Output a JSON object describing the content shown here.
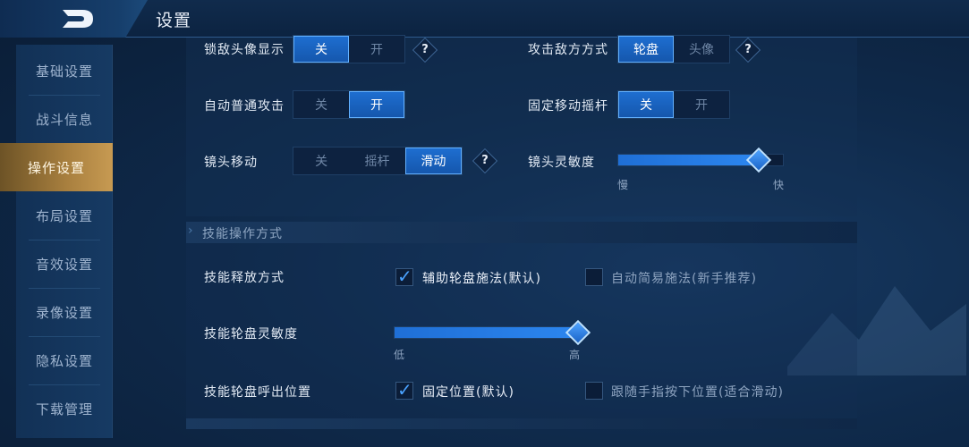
{
  "header": {
    "title": "设置"
  },
  "sidebar": {
    "items": [
      {
        "label": "基础设置"
      },
      {
        "label": "战斗信息"
      },
      {
        "label": "操作设置"
      },
      {
        "label": "布局设置"
      },
      {
        "label": "音效设置"
      },
      {
        "label": "录像设置"
      },
      {
        "label": "隐私设置"
      },
      {
        "label": "下载管理"
      }
    ],
    "active_index": 2
  },
  "settings": {
    "lock_enemy_avatar": {
      "label": "锁敌头像显示",
      "options": [
        "关",
        "开"
      ],
      "selected": "关"
    },
    "attack_enemy_mode": {
      "label": "攻击敌方方式",
      "options": [
        "轮盘",
        "头像"
      ],
      "selected": "轮盘"
    },
    "auto_attack": {
      "label": "自动普通攻击",
      "options": [
        "关",
        "开"
      ],
      "selected": "开"
    },
    "fixed_joystick": {
      "label": "固定移动摇杆",
      "options": [
        "关",
        "开"
      ],
      "selected": "关"
    },
    "camera_move": {
      "label": "镜头移动",
      "options": [
        "关",
        "摇杆",
        "滑动"
      ],
      "selected": "滑动"
    },
    "camera_sensitivity": {
      "label": "镜头灵敏度",
      "min_label": "慢",
      "max_label": "快",
      "value": 0.85
    },
    "help_glyph": "?"
  },
  "skill_section": {
    "title": "技能操作方式",
    "release_mode": {
      "label": "技能释放方式",
      "option_a": "辅助轮盘施法(默认)",
      "option_b": "自动简易施法(新手推荐)",
      "checked": "a"
    },
    "wheel_sensitivity": {
      "label": "技能轮盘灵敏度",
      "min_label": "低",
      "max_label": "高",
      "value": 1.0
    },
    "wheel_position": {
      "label": "技能轮盘呼出位置",
      "option_a": "固定位置(默认)",
      "option_b": "跟随手指按下位置(适合滑动)",
      "checked": "a"
    }
  },
  "colors": {
    "accent": "#1e6ed0",
    "active_tab": "#a9803f"
  }
}
